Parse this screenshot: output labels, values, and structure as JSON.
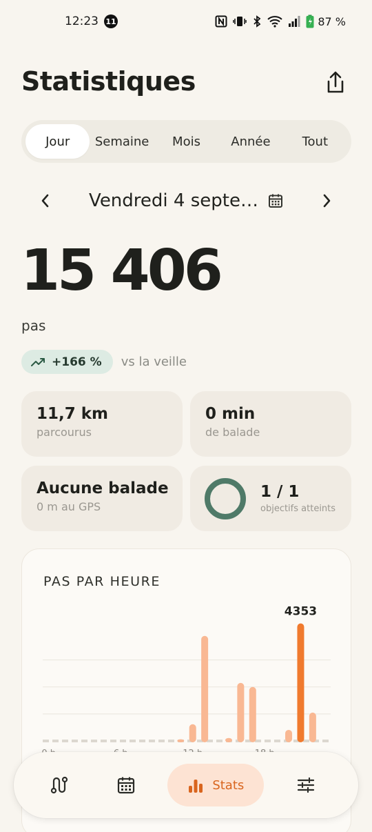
{
  "status_bar": {
    "time": "12:23",
    "notification_count": "11",
    "battery": "87 %"
  },
  "header": {
    "title": "Statistiques"
  },
  "tabs": [
    {
      "label": "Jour",
      "active": true
    },
    {
      "label": "Semaine",
      "active": false
    },
    {
      "label": "Mois",
      "active": false
    },
    {
      "label": "Année",
      "active": false
    },
    {
      "label": "Tout",
      "active": false
    }
  ],
  "date_nav": {
    "label": "Vendredi 4 septe…"
  },
  "summary": {
    "steps": "15 406",
    "unit": "pas",
    "trend_value": "+166 %",
    "trend_compare": "vs la veille"
  },
  "cards": {
    "distance": {
      "value": "11,7 km",
      "label": "parcourus"
    },
    "walk_time": {
      "value": "0 min",
      "label": "de balade"
    },
    "gps": {
      "value": "Aucune balade",
      "label": "0 m au GPS"
    },
    "goals": {
      "value": "1 / 1",
      "label": "objectifs atteints",
      "progress": 1.0
    }
  },
  "chart_data": {
    "type": "bar",
    "title": "PAS PAR HEURE",
    "x": [
      0,
      1,
      2,
      3,
      4,
      5,
      6,
      7,
      8,
      9,
      10,
      11,
      12,
      13,
      14,
      15,
      16,
      17,
      18,
      19,
      20,
      21,
      22,
      23
    ],
    "values": [
      0,
      0,
      0,
      0,
      0,
      0,
      0,
      0,
      0,
      0,
      0,
      60,
      620,
      3890,
      0,
      110,
      2150,
      2000,
      0,
      0,
      410,
      4353,
      1050,
      0
    ],
    "ylim": [
      0,
      4600
    ],
    "max_label": "4353",
    "tick_labels": [
      "0 h",
      "6 h",
      "12 h",
      "18 h"
    ],
    "grid": true
  },
  "colors": {
    "accent": "#f07a2e",
    "bar": "#f9b893",
    "trend_bg": "#ddebe3",
    "goal_ring": "#4f7a68"
  },
  "bottom_nav": {
    "items": [
      {
        "icon": "route-icon"
      },
      {
        "icon": "calendar-icon"
      },
      {
        "icon": "bar-chart-icon",
        "label": "Stats",
        "active": true
      },
      {
        "icon": "sliders-icon"
      }
    ]
  }
}
